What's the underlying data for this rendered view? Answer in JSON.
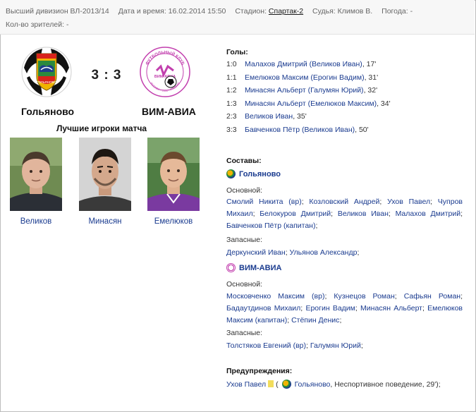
{
  "match_info": {
    "division": "Высший дивизион ВЛ-2013/14",
    "datetime_label": "Дата и время:",
    "datetime_value": "16.02.2014 15:50",
    "stadium_label": "Стадион:",
    "stadium_value": "Спартак-2",
    "referee_label": "Судья:",
    "referee_value": "Климов В.",
    "weather_label": "Погода:",
    "weather_value": "-",
    "spectators_label": "Кол-во зрителей:",
    "spectators_value": "-"
  },
  "score": "3 : 3",
  "home_team": {
    "name": "Гольяново",
    "logo_icon": "golyanovo-crest-icon",
    "logo_text": "ГОЛЬЯНОВО"
  },
  "away_team": {
    "name": "ВИМ-АВИА",
    "logo_icon": "vim-avia-crest-icon",
    "logo_text": "ВИМ-АВИА",
    "logo_ring_text": "ФУТБОЛЬНЫЙ КЛУБ",
    "logo_ring_bottom": "МОСКВА • 2006 • РОССИЯ"
  },
  "best_players": {
    "title": "Лучшие игроки матча",
    "players": [
      {
        "name": "Великов"
      },
      {
        "name": "Минасян"
      },
      {
        "name": "Емелюков"
      }
    ]
  },
  "goals": {
    "title": "Голы:",
    "items": [
      {
        "score": "1:0",
        "text": "Малахов Дмитрий (Великов Иван)",
        "minute": ", 17'"
      },
      {
        "score": "1:1",
        "text": "Емелюков Максим (Ерогин Вадим)",
        "minute": ", 31'"
      },
      {
        "score": "1:2",
        "text": "Минасян Альберт (Галумян Юрий)",
        "minute": ", 32'"
      },
      {
        "score": "1:3",
        "text": "Минасян Альберт (Емелюков Максим)",
        "minute": ", 34'"
      },
      {
        "score": "2:3",
        "text": "Великов Иван",
        "minute": ", 35'"
      },
      {
        "score": "3:3",
        "text": "Бавченков Пётр (Великов Иван)",
        "minute": ", 50'"
      }
    ]
  },
  "lineups": {
    "title": "Составы:",
    "main_label": "Основной:",
    "subs_label": "Запасные:",
    "home": {
      "name": "Гольяново",
      "main": [
        "Смолий Никита (вр)",
        "Козловский Андрей",
        "Ухов Павел",
        "Чупров Михаил",
        "Белокуров Дмитрий",
        "Великов Иван",
        "Малахов Дмитрий",
        "Бавченков Пётр (капитан)"
      ],
      "subs": [
        "Деркунский Иван",
        "Ульянов Александр"
      ]
    },
    "away": {
      "name": "ВИМ-АВИА",
      "main": [
        "Московченко Максим (вр)",
        "Кузнецов Роман",
        "Сафьян Роман",
        "Бадаутдинов Михаил",
        "Ерогин Вадим",
        "Минасян Альберт",
        "Емелюков Максим (капитан)",
        "Стёпин Денис"
      ],
      "subs": [
        "Толстяков Евгений (вр)",
        "Галумян Юрий"
      ]
    }
  },
  "warnings": {
    "title": "Предупреждения:",
    "items": [
      {
        "player": "Ухов Павел",
        "open_paren": "(",
        "team": "Гольяново",
        "reason": ", Неспортивное поведение, 29');"
      }
    ]
  },
  "colors": {
    "link": "#1a3b8f",
    "yellow_card": "#f2dd5c",
    "border": "#bdbdbd"
  }
}
